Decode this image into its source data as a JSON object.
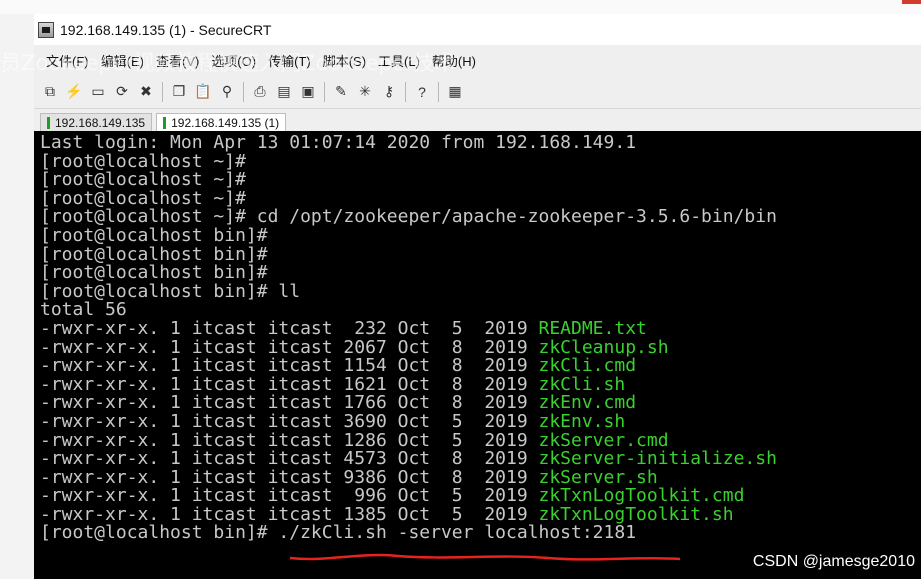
{
  "window": {
    "title": "192.168.149.135 (1) - SecureCRT"
  },
  "menu": [
    "文件(F)",
    "编辑(E)",
    "查看(V)",
    "选项(O)",
    "传输(T)",
    "脚本(S)",
    "工具(L)",
    "帮助(H)"
  ],
  "tabs": [
    {
      "label": "192.168.149.135",
      "active": false
    },
    {
      "label": "192.168.149.135 (1)",
      "active": true
    }
  ],
  "toolbar_icons": [
    "connect-icon",
    "quick-connect-icon",
    "tab-connect-icon",
    "reconnect-icon",
    "disconnect-icon",
    "copy-icon",
    "paste-icon",
    "find-icon",
    "print-icon",
    "print-setup-icon",
    "print-screen-icon",
    "session-options-icon",
    "global-options-icon",
    "keymap-icon",
    "help-icon",
    "sftp-icon"
  ],
  "terminal": {
    "prompt_home": "[root@localhost ~]#",
    "prompt_bin": "[root@localhost bin]#",
    "last_login": "Last login: Mon Apr 13 01:07:14 2020 from 192.168.149.1",
    "cd_cmd": " cd /opt/zookeeper/apache-zookeeper-3.5.6-bin/bin",
    "ll_cmd": " ll",
    "total": "total 56",
    "files": [
      {
        "meta": "-rwxr-xr-x. 1 itcast itcast  232 Oct  5  2019 ",
        "name": "README.txt"
      },
      {
        "meta": "-rwxr-xr-x. 1 itcast itcast 2067 Oct  8  2019 ",
        "name": "zkCleanup.sh"
      },
      {
        "meta": "-rwxr-xr-x. 1 itcast itcast 1154 Oct  8  2019 ",
        "name": "zkCli.cmd"
      },
      {
        "meta": "-rwxr-xr-x. 1 itcast itcast 1621 Oct  8  2019 ",
        "name": "zkCli.sh"
      },
      {
        "meta": "-rwxr-xr-x. 1 itcast itcast 1766 Oct  8  2019 ",
        "name": "zkEnv.cmd"
      },
      {
        "meta": "-rwxr-xr-x. 1 itcast itcast 3690 Oct  5  2019 ",
        "name": "zkEnv.sh"
      },
      {
        "meta": "-rwxr-xr-x. 1 itcast itcast 1286 Oct  5  2019 ",
        "name": "zkServer.cmd"
      },
      {
        "meta": "-rwxr-xr-x. 1 itcast itcast 4573 Oct  8  2019 ",
        "name": "zkServer-initialize.sh"
      },
      {
        "meta": "-rwxr-xr-x. 1 itcast itcast 9386 Oct  8  2019 ",
        "name": "zkServer.sh"
      },
      {
        "meta": "-rwxr-xr-x. 1 itcast itcast  996 Oct  5  2019 ",
        "name": "zkTxnLogToolkit.cmd"
      },
      {
        "meta": "-rwxr-xr-x. 1 itcast itcast 1385 Oct  5  2019 ",
        "name": "zkTxnLogToolkit.sh"
      }
    ],
    "final_cmd": " ./zkCli.sh -server localhost:2181"
  },
  "overlay_text": "员Zookeeper视频教程快速入门Zookeeper技术",
  "watermark": "CSDN @jamesge2010",
  "colors": {
    "terminal_bg": "#000000",
    "terminal_fg": "#c8c8c8",
    "filename": "#39d12e",
    "underline": "#e8231f",
    "tab_indicator": "#1a9d2b"
  }
}
